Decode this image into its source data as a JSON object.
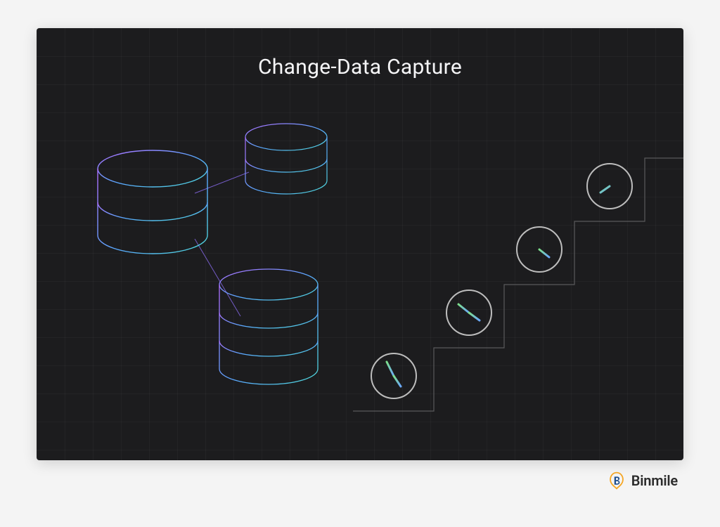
{
  "title": "Change-Data Capture",
  "brand": {
    "name": "Binmile"
  },
  "colors": {
    "bg": "#1c1c1e",
    "grid": "rgba(255,255,255,0.03)",
    "title": "#f5f5f7",
    "stroke_purple": "#9d6cff",
    "stroke_teal": "#4dd8d8",
    "stroke_blue": "#5aa8ff",
    "clock_ring": "#bdbdbd",
    "clock_hand_green": "#7de08a",
    "clock_hand_blue": "#6aa7ff",
    "stair": "#5a5a5c"
  },
  "databases": [
    {
      "id": "db-main",
      "layers": 3,
      "size": "large"
    },
    {
      "id": "db-top",
      "layers": 3,
      "size": "medium"
    },
    {
      "id": "db-bottom",
      "layers": 4,
      "size": "medium"
    }
  ],
  "clocks": [
    {
      "id": "clock-1",
      "step": 1
    },
    {
      "id": "clock-2",
      "step": 2
    },
    {
      "id": "clock-3",
      "step": 3
    },
    {
      "id": "clock-4",
      "step": 4
    }
  ],
  "staircase_steps": 5
}
